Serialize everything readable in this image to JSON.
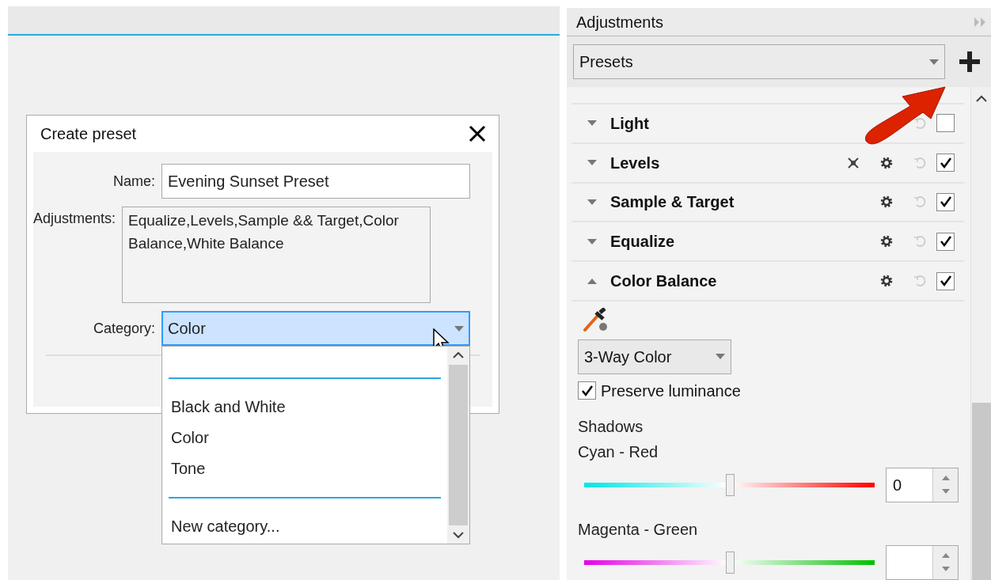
{
  "dialog": {
    "title": "Create preset",
    "fields": [
      {
        "kind": "input",
        "label": "Name:",
        "value": "Evening Sunset Preset"
      },
      {
        "kind": "textarea",
        "label": "Adjustments:",
        "value": "Equalize,Levels,Sample && Target,Color Balance,White Balance"
      },
      {
        "kind": "select",
        "label": "Category:",
        "value": "Color"
      }
    ]
  },
  "category_list": [
    {
      "kind": "separator"
    },
    {
      "kind": "item",
      "label": "Black and White"
    },
    {
      "kind": "item",
      "label": "Color"
    },
    {
      "kind": "item",
      "label": "Tone"
    },
    {
      "kind": "separator"
    },
    {
      "kind": "item",
      "label": "New category..."
    }
  ],
  "panel": {
    "title": "Adjustments",
    "presets": {
      "value": "Presets"
    },
    "adjustments": [
      {
        "name": "Light",
        "expanded": false,
        "enabled": false,
        "auto": false,
        "settings": false
      },
      {
        "name": "Levels",
        "expanded": false,
        "enabled": true,
        "auto": true,
        "settings": true
      },
      {
        "name": "Sample & Target",
        "expanded": false,
        "enabled": true,
        "auto": false,
        "settings": true
      },
      {
        "name": "Equalize",
        "expanded": false,
        "enabled": true,
        "auto": false,
        "settings": true
      },
      {
        "name": "Color Balance",
        "expanded": true,
        "enabled": true,
        "auto": false,
        "settings": true
      }
    ],
    "mode": {
      "value": "3-Way Color"
    },
    "preserve_luminance": {
      "label": "Preserve luminance",
      "checked": true
    },
    "section": "Shadows",
    "sliders": [
      {
        "kind": "cyan_red",
        "label": "Cyan - Red",
        "level": 0.5,
        "value": "0"
      },
      {
        "kind": "magenta_green",
        "label": "Magenta - Green",
        "level": 0.5
      }
    ]
  }
}
